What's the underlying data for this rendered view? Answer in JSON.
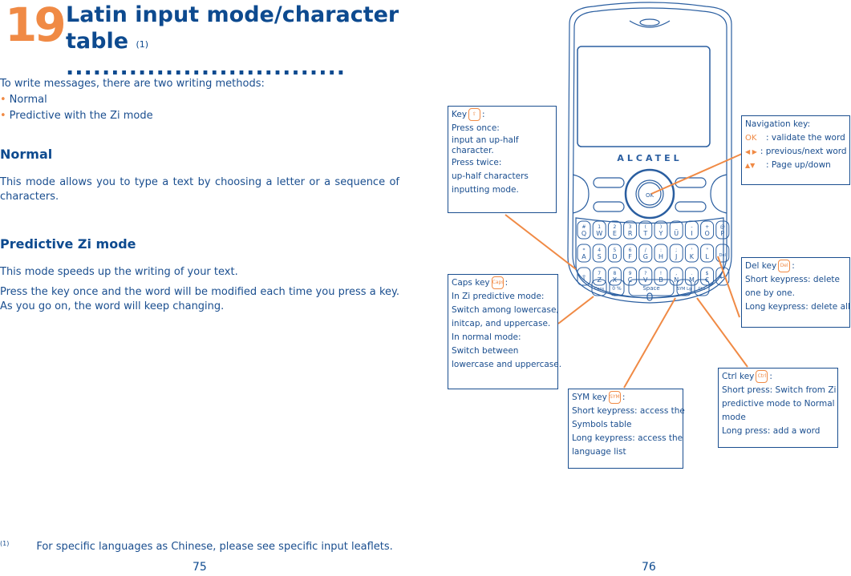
{
  "left_page": {
    "chapter_number": "19",
    "title_line1": "Latin input mode/character",
    "title_line2": "table",
    "title_footnote_ref": "(1)",
    "title_dots": "...............................",
    "intro": "To write messages, there are two writing methods:",
    "bullets": [
      "Normal",
      "Predictive with the Zi mode"
    ],
    "sections": [
      {
        "heading": "Normal",
        "paragraphs": [
          "This mode allows you to type a text by choosing a letter or a sequence of characters."
        ]
      },
      {
        "heading": "Predictive Zi mode",
        "paragraphs": [
          "This mode speeds up the writing of your text.",
          "Press the key once and the word will be modified each time you press a key. As you go on, the word will keep changing."
        ]
      }
    ],
    "footnote_marker": "(1)",
    "footnote_text": "For specific languages as Chinese, please see specific input leaflets.",
    "page_number": "75"
  },
  "right_page": {
    "phone_brand": "ALCATEL",
    "ok_label": "OK",
    "space_label": "Space",
    "keyboard": {
      "row1": [
        [
          "#",
          "Q"
        ],
        [
          "1",
          "W"
        ],
        [
          "2",
          "E"
        ],
        [
          "3",
          "R"
        ],
        [
          "(",
          "T"
        ],
        [
          ")",
          "Y"
        ],
        [
          "_",
          "U"
        ],
        [
          "-",
          "I"
        ],
        [
          "+",
          "O"
        ],
        [
          "@",
          "P"
        ]
      ],
      "row2": [
        [
          "*",
          "A"
        ],
        [
          "4",
          "S"
        ],
        [
          "5",
          "D"
        ],
        [
          "6",
          "F"
        ],
        [
          "/",
          "G"
        ],
        [
          ":",
          "H"
        ],
        [
          ";",
          "J"
        ],
        [
          "'",
          "K"
        ],
        [
          "\"",
          "L"
        ],
        [
          "",
          "Del"
        ]
      ],
      "row3": [
        [
          "",
          "⇧"
        ],
        [
          "7",
          "Z"
        ],
        [
          "8",
          "X"
        ],
        [
          "9",
          "C"
        ],
        [
          "?",
          "V"
        ],
        [
          "!",
          "B"
        ],
        [
          ",",
          "N"
        ],
        [
          ".",
          "M"
        ],
        [
          "$",
          "€"
        ],
        [
          "",
          "↵"
        ]
      ],
      "row4": [
        "Caps",
        "0 %",
        "Space",
        "SYM Lg",
        "Ctrl"
      ]
    },
    "callouts": {
      "key": {
        "title": "Key",
        "icon": "shift-key-icon",
        "lines": [
          "Press once:",
          "input an up-half",
          "character.",
          "Press twice:",
          "up-half characters",
          "inputting mode."
        ]
      },
      "caps": {
        "title": "Caps key",
        "icon": "caps-key-icon",
        "icon_label": "Caps",
        "lines": [
          "In Zi predictive mode:",
          "Switch among lowercase,",
          "initcap, and uppercase.",
          "In normal mode:",
          "Switch between",
          "lowercase and uppercase."
        ]
      },
      "navigation": {
        "title": "Navigation key:",
        "items": [
          {
            "symbol": "OK",
            "icon": "ok-icon",
            "text": ": validate the word"
          },
          {
            "symbol": "◀ ▶",
            "icon": "left-right-arrows-icon",
            "text": ": previous/next word"
          },
          {
            "symbol": "▲▼",
            "icon": "up-down-arrows-icon",
            "text": ": Page up/down"
          }
        ]
      },
      "del": {
        "title": "Del key",
        "icon": "del-key-icon",
        "icon_label": "Del",
        "lines": [
          "Short keypress: delete",
          "one by one.",
          "Long keypress: delete all."
        ]
      },
      "ctrl": {
        "title": "Ctrl key",
        "icon": "ctrl-key-icon",
        "icon_label": "Ctrl",
        "lines": [
          "Short press: Switch from Zi",
          "predictive mode to Normal",
          "mode",
          "Long press: add a word"
        ]
      },
      "sym": {
        "title": "SYM key",
        "icon": "sym-key-icon",
        "icon_label": "SYM",
        "lines": [
          "Short keypress: access the",
          "Symbols table",
          "Long keypress: access the",
          "language list"
        ]
      }
    },
    "page_number": "76"
  },
  "colors": {
    "text_blue": "#1a4e8f",
    "heading_blue": "#0d4a8f",
    "accent_orange": "#f08a45",
    "phone_line": "#2a5ea0"
  }
}
